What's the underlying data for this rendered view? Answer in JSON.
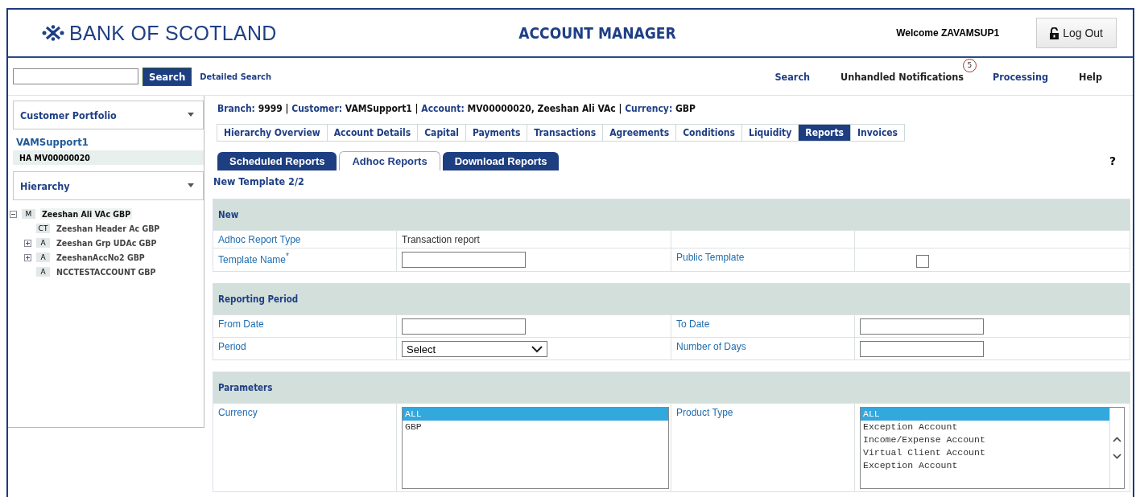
{
  "header": {
    "logo": "BANK OF SCOTLAND",
    "title": "ACCOUNT MANAGER",
    "welcome": "Welcome ZAVAMSUP1",
    "logout": "Log Out"
  },
  "toolbar": {
    "search_button": "Search",
    "detailed_search": "Detailed Search",
    "nav": [
      {
        "label": "Search",
        "kind": "link"
      },
      {
        "label": "Unhandled Notifications",
        "kind": "plain",
        "badge": "5"
      },
      {
        "label": "Processing",
        "kind": "link"
      },
      {
        "label": "Help",
        "kind": "plain"
      }
    ]
  },
  "sidebar": {
    "portfolio": {
      "title": "Customer Portfolio",
      "customer": "VAMSupport1",
      "account": "HA MV00000020"
    },
    "hierarchy": {
      "title": "Hierarchy",
      "tree": [
        {
          "type": "M",
          "label": "Zeeshan Ali VAc GBP",
          "selected": true,
          "expanded": true,
          "children": [
            {
              "type": "CT",
              "label": "Zeeshan Header Ac GBP",
              "selected": false
            },
            {
              "type": "A",
              "label": "Zeeshan Grp UDAc GBP",
              "selected": false,
              "expanded": false
            },
            {
              "type": "A",
              "label": "ZeeshanAccNo2 GBP",
              "selected": false,
              "expanded": false
            },
            {
              "type": "A",
              "label": "NCCTESTACCOUNT GBP",
              "selected": false
            }
          ]
        }
      ]
    }
  },
  "breadcrumb_separator": "|",
  "breadcrumb": [
    {
      "label": "Branch:",
      "value": "9999"
    },
    {
      "label": "Customer:",
      "value": "VAMSupport1"
    },
    {
      "label": "Account:",
      "value": "MV00000020, Zeeshan Ali VAc"
    },
    {
      "label": "Currency:",
      "value": "GBP"
    }
  ],
  "tabs": [
    {
      "label": "Hierarchy Overview",
      "selected": false
    },
    {
      "label": "Account Details",
      "selected": false
    },
    {
      "label": "Capital",
      "selected": false
    },
    {
      "label": "Payments",
      "selected": false
    },
    {
      "label": "Transactions",
      "selected": false
    },
    {
      "label": "Agreements",
      "selected": false
    },
    {
      "label": "Conditions",
      "selected": false
    },
    {
      "label": "Liquidity",
      "selected": false
    },
    {
      "label": "Reports",
      "selected": true
    },
    {
      "label": "Invoices",
      "selected": false
    }
  ],
  "subtabs": [
    {
      "label": "Scheduled Reports",
      "selected": false
    },
    {
      "label": "Adhoc Reports",
      "selected": true
    },
    {
      "label": "Download Reports",
      "selected": false
    }
  ],
  "help": "?",
  "form_title": "New Template 2/2",
  "sections": [
    {
      "title": "New",
      "rows": [
        {
          "cells": [
            {
              "kind": "label",
              "text": "Adhoc Report Type"
            },
            {
              "kind": "text",
              "text": "Transaction report"
            },
            {
              "kind": "empty"
            },
            {
              "kind": "empty"
            }
          ]
        },
        {
          "cells": [
            {
              "kind": "label",
              "text": "Template Name$^{*}$"
            },
            {
              "kind": "input"
            },
            {
              "kind": "label",
              "text": "Public Template"
            },
            {
              "kind": "checkbox",
              "checked": false
            }
          ]
        }
      ]
    },
    {
      "title": "Reporting Period",
      "rows": [
        {
          "cells": [
            {
              "kind": "label",
              "text": "From Date"
            },
            {
              "kind": "input"
            },
            {
              "kind": "label",
              "text": "To Date"
            },
            {
              "kind": "input"
            }
          ]
        },
        {
          "cells": [
            {
              "kind": "label",
              "text": "Period"
            },
            {
              "kind": "select",
              "value": "Select"
            },
            {
              "kind": "label",
              "text": "Number of Days"
            },
            {
              "kind": "input"
            }
          ]
        }
      ]
    },
    {
      "title": "Parameters",
      "rows": [
        {
          "cells": [
            {
              "kind": "label",
              "text": "Currency"
            },
            {
              "kind": "listbox",
              "scrollbar": false,
              "options": [
                {
                  "label": "ALL",
                  "selected": true
                },
                {
                  "label": "GBP",
                  "selected": false
                }
              ]
            },
            {
              "kind": "label",
              "text": "Product Type"
            },
            {
              "kind": "listbox",
              "scrollbar": true,
              "options": [
                {
                  "label": "ALL",
                  "selected": true
                },
                {
                  "label": "Exception Account",
                  "selected": false
                },
                {
                  "label": "Income/Expense Account",
                  "selected": false
                },
                {
                  "label": "Virtual Client Account",
                  "selected": false
                },
                {
                  "label": "Exception Account",
                  "selected": false
                }
              ]
            }
          ]
        }
      ]
    }
  ]
}
